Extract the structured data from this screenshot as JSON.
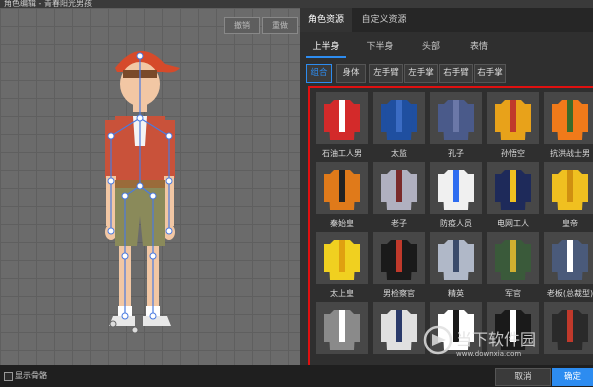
{
  "window": {
    "title": "角色编辑 - 青春阳光男孩"
  },
  "canvas": {
    "undo_label": "撤销",
    "redo_label": "重做"
  },
  "tabs": [
    {
      "label": "角色资源",
      "active": true
    },
    {
      "label": "自定义资源",
      "active": false
    }
  ],
  "categories": [
    {
      "label": "上半身",
      "active": true
    },
    {
      "label": "下半身",
      "active": false
    },
    {
      "label": "头部",
      "active": false
    },
    {
      "label": "表情",
      "active": false
    }
  ],
  "subcategories": [
    {
      "label": "组合",
      "active": true
    },
    {
      "label": "身体",
      "active": false
    },
    {
      "label": "左手臂",
      "active": false
    },
    {
      "label": "左手掌",
      "active": false
    },
    {
      "label": "右手臂",
      "active": false
    },
    {
      "label": "右手掌",
      "active": false
    }
  ],
  "items": [
    {
      "label": "石油工人男",
      "color": "#d32a2a",
      "accent": "#ffffff"
    },
    {
      "label": "太监",
      "color": "#1f4fa0",
      "accent": "#3b6cc4"
    },
    {
      "label": "孔子",
      "color": "#4a5a8a",
      "accent": "#6b78a8"
    },
    {
      "label": "孙悟空",
      "color": "#e8a21a",
      "accent": "#c0392b"
    },
    {
      "label": "抗洪战士男",
      "color": "#f07a1a",
      "accent": "#3a6a2a"
    },
    {
      "label": "秦始皇",
      "color": "#e07a1a",
      "accent": "#222222"
    },
    {
      "label": "老子",
      "color": "#b0b0c0",
      "accent": "#7a2a2a"
    },
    {
      "label": "防疫人员",
      "color": "#f0f0f0",
      "accent": "#2d6cf0"
    },
    {
      "label": "电网工人",
      "color": "#1e2a5a",
      "accent": "#f0c020"
    },
    {
      "label": "皇帝",
      "color": "#f0c020",
      "accent": "#d09010"
    },
    {
      "label": "太上皇",
      "color": "#f0d020",
      "accent": "#e0a010"
    },
    {
      "label": "男检察官",
      "color": "#1a1a1a",
      "accent": "#c0392b"
    },
    {
      "label": "精英",
      "color": "#b0b8c8",
      "accent": "#3a4a6a"
    },
    {
      "label": "军官",
      "color": "#3a5a3a",
      "accent": "#d0b030"
    },
    {
      "label": "老板(总裁型)",
      "color": "#4a5a7a",
      "accent": "#ffffff"
    },
    {
      "label": "",
      "color": "#8a8a8a",
      "accent": "#ffffff"
    },
    {
      "label": "",
      "color": "#e0e0e0",
      "accent": "#2a3a6a"
    },
    {
      "label": "",
      "color": "#ffffff",
      "accent": "#1a1a1a"
    },
    {
      "label": "",
      "color": "#1a1a1a",
      "accent": "#ffffff"
    },
    {
      "label": "",
      "color": "#2a2a2a",
      "accent": "#c0392b"
    }
  ],
  "footer": {
    "show_bones_label": "显示骨骼",
    "cancel_label": "取消",
    "ok_label": "确定"
  },
  "watermark": {
    "text": "当下软件园",
    "subtext": "www.downxia.com"
  },
  "colors": {
    "accent": "#2d8cf0",
    "highlight_border": "#e01010"
  }
}
